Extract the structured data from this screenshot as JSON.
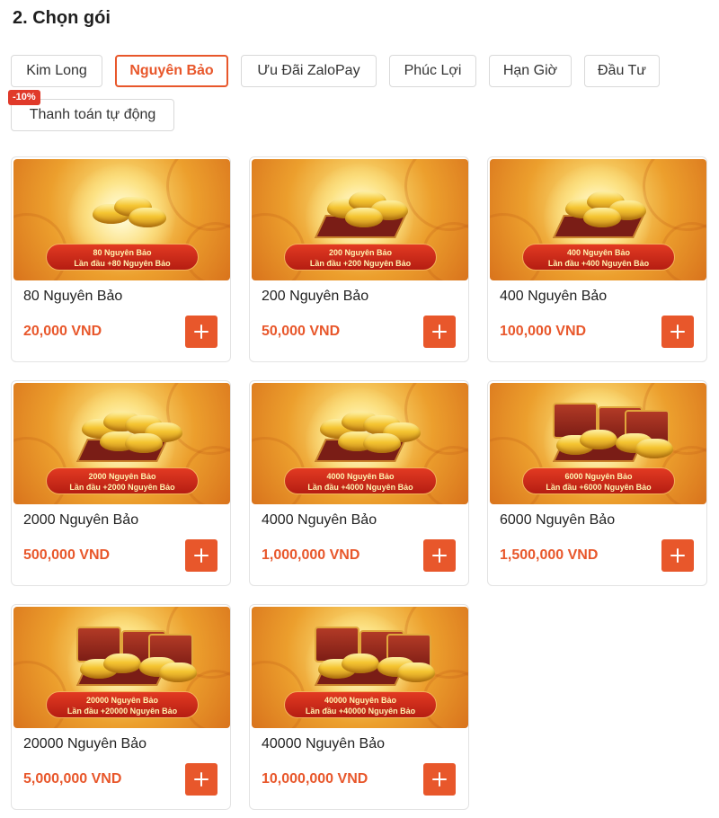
{
  "section": {
    "title": "2. Chọn gói"
  },
  "tabs": [
    {
      "label": "Kim Long",
      "active": false
    },
    {
      "label": "Nguyên Bảo",
      "active": true
    },
    {
      "label": "Ưu Đãi ZaloPay",
      "active": false
    },
    {
      "label": "Phúc Lợi",
      "active": false
    },
    {
      "label": "Hạn Giờ",
      "active": false
    },
    {
      "label": "Đầu Tư",
      "active": false
    },
    {
      "label": "Thanh toán tự động",
      "active": false,
      "badge": "-10%"
    }
  ],
  "packages": [
    {
      "name": "80 Nguyên Bảo",
      "price": "20,000 VND",
      "banner_line1": "80 Nguyên Bảo",
      "banner_line2": "Lần đầu +80 Nguyên Bảo",
      "tier": 1
    },
    {
      "name": "200 Nguyên Bảo",
      "price": "50,000 VND",
      "banner_line1": "200 Nguyên Bảo",
      "banner_line2": "Lần đầu +200 Nguyên Bảo",
      "tier": 2
    },
    {
      "name": "400 Nguyên Bảo",
      "price": "100,000 VND",
      "banner_line1": "400 Nguyên Bảo",
      "banner_line2": "Lần đầu +400 Nguyên Bảo",
      "tier": 2
    },
    {
      "name": "2000 Nguyên Bảo",
      "price": "500,000 VND",
      "banner_line1": "2000 Nguyên Bảo",
      "banner_line2": "Lần đầu +2000 Nguyên Bảo",
      "tier": 3
    },
    {
      "name": "4000 Nguyên Bảo",
      "price": "1,000,000 VND",
      "banner_line1": "4000 Nguyên Bảo",
      "banner_line2": "Lần đầu +4000 Nguyên Bảo",
      "tier": 3
    },
    {
      "name": "6000 Nguyên Bảo",
      "price": "1,500,000 VND",
      "banner_line1": "6000 Nguyên Bảo",
      "banner_line2": "Lần đầu +6000 Nguyên Bảo",
      "tier": 4
    },
    {
      "name": "20000 Nguyên Bảo",
      "price": "5,000,000 VND",
      "banner_line1": "20000 Nguyên Bảo",
      "banner_line2": "Lần đầu +20000 Nguyên Bảo",
      "tier": 4
    },
    {
      "name": "40000 Nguyên Bảo",
      "price": "10,000,000 VND",
      "banner_line1": "40000 Nguyên Bảo",
      "banner_line2": "Lần đầu +40000 Nguyên Bảo",
      "tier": 4
    }
  ],
  "colors": {
    "accent": "#e8572b",
    "badge": "#e03a2a"
  },
  "icons": {
    "add": "plus-icon"
  }
}
